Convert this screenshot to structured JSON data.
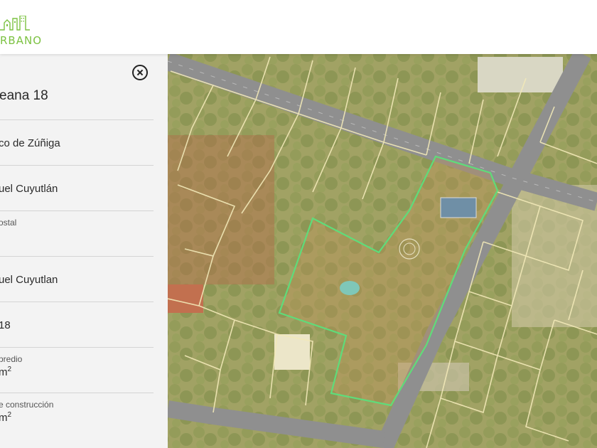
{
  "brand": {
    "logo_text": "RBANO",
    "accent": "#7cc242"
  },
  "panel": {
    "title": "eana 18",
    "close_icon": "close-circle-icon",
    "fields": [
      {
        "label": "",
        "value": "co de Zúñiga"
      },
      {
        "label": "",
        "value": "uel Cuyutlán"
      },
      {
        "label": "ostal",
        "value": ""
      },
      {
        "label": "",
        "value": "uel Cuyutlan"
      },
      {
        "label": "",
        "value": "18"
      },
      {
        "label": "predio",
        "value": "m",
        "unit_sup": "2"
      },
      {
        "label": "e construcción",
        "value": "m",
        "unit_sup": "2"
      }
    ]
  },
  "map": {
    "type": "satellite",
    "parcel_outline_color": "#5fdc7a",
    "parcel_lines_color": "#f2e9b8"
  }
}
